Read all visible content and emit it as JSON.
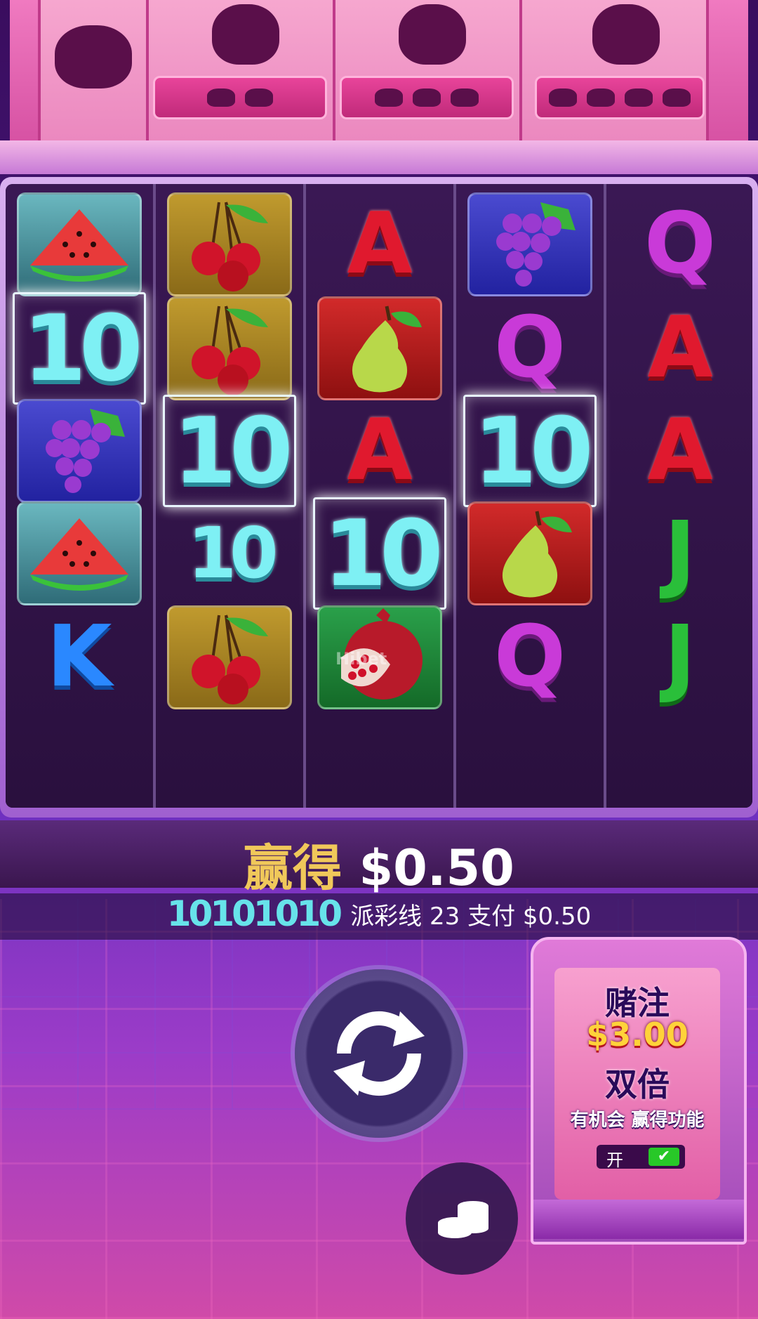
{
  "win": {
    "label": "赢得",
    "amount": "$0.50"
  },
  "line_info": {
    "symbols": "10101010",
    "text": "派彩线 23 支付 $0.50"
  },
  "bet": {
    "title": "赌注",
    "amount": "$3.00",
    "double": "双倍",
    "feature": "有机会 赢得功能",
    "toggle_label": "开",
    "toggle_check": "✔"
  },
  "watermark": "Hibet",
  "reels": [
    [
      "watermelon",
      "10",
      "grapes",
      "watermelon",
      "K"
    ],
    [
      "cherries",
      "cherries",
      "10",
      "10",
      "cherries"
    ],
    [
      "A",
      "pear",
      "A",
      "10",
      "pomegranate"
    ],
    [
      "grapes",
      "Q",
      "10",
      "pear",
      "Q"
    ],
    [
      "Q",
      "A",
      "A",
      "J",
      "J"
    ]
  ],
  "colors": {
    "accent": "#f0c85a",
    "highlight": "#e8f6ff"
  }
}
